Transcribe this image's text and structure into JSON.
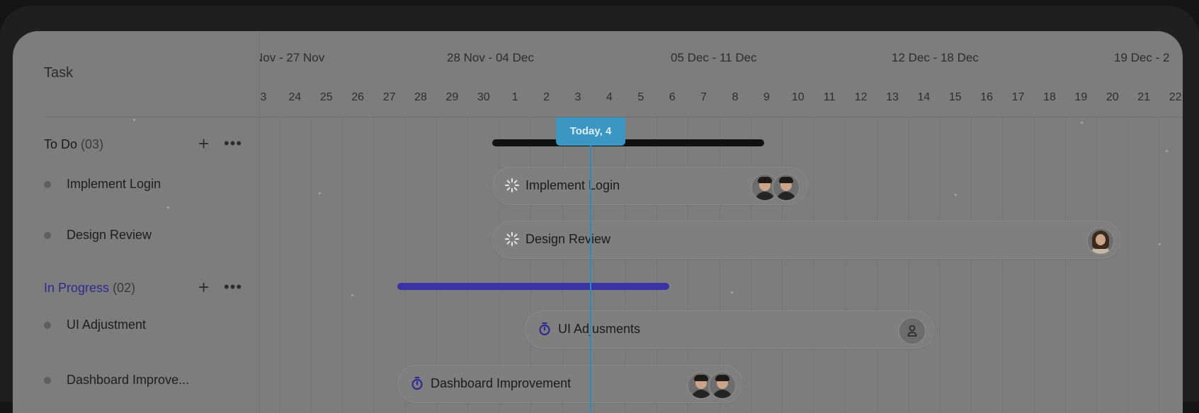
{
  "task_column": {
    "header": "Task"
  },
  "timeline": {
    "weeks": [
      "Nov - 27 Nov",
      "28 Nov - 04 Dec",
      "05 Dec - 11 Dec",
      "12 Dec - 18 Dec",
      "19 Dec - 2"
    ],
    "days": [
      "3",
      "24",
      "25",
      "26",
      "27",
      "28",
      "29",
      "30",
      "1",
      "2",
      "3",
      "4",
      "5",
      "6",
      "7",
      "8",
      "9",
      "10",
      "11",
      "12",
      "13",
      "14",
      "15",
      "16",
      "17",
      "18",
      "19",
      "20",
      "21",
      "22"
    ],
    "today_label": "Today, 4"
  },
  "groups": [
    {
      "title": "To Do",
      "count": "(03)",
      "color": "#1b1b1b",
      "bar_color": "#111111",
      "add_icon": "plus-icon",
      "more_icon": "more-horizontal-icon",
      "tasks": [
        {
          "list_label": "Implement Login",
          "pill_label": "Implement Login",
          "status_icon": "loading-spinner-icon",
          "avatars": [
            "male-1",
            "male-2"
          ]
        },
        {
          "list_label": "Design Review",
          "pill_label": "Design Review",
          "status_icon": "loading-spinner-icon",
          "avatars": [
            "female-1"
          ]
        }
      ]
    },
    {
      "title": "In Progress",
      "count": "(02)",
      "color": "#2f2a8e",
      "bar_color": "#3a33a8",
      "add_icon": "plus-icon",
      "more_icon": "more-horizontal-icon",
      "tasks": [
        {
          "list_label": "UI Adjustment",
          "pill_label": "UI Adjusments",
          "status_icon": "stopwatch-icon",
          "avatars": [
            "generic-user"
          ]
        },
        {
          "list_label": "Dashboard Improve...",
          "pill_label": "Dashboard Improvement",
          "status_icon": "stopwatch-icon",
          "avatars": [
            "male-1",
            "male-2"
          ]
        }
      ]
    }
  ]
}
